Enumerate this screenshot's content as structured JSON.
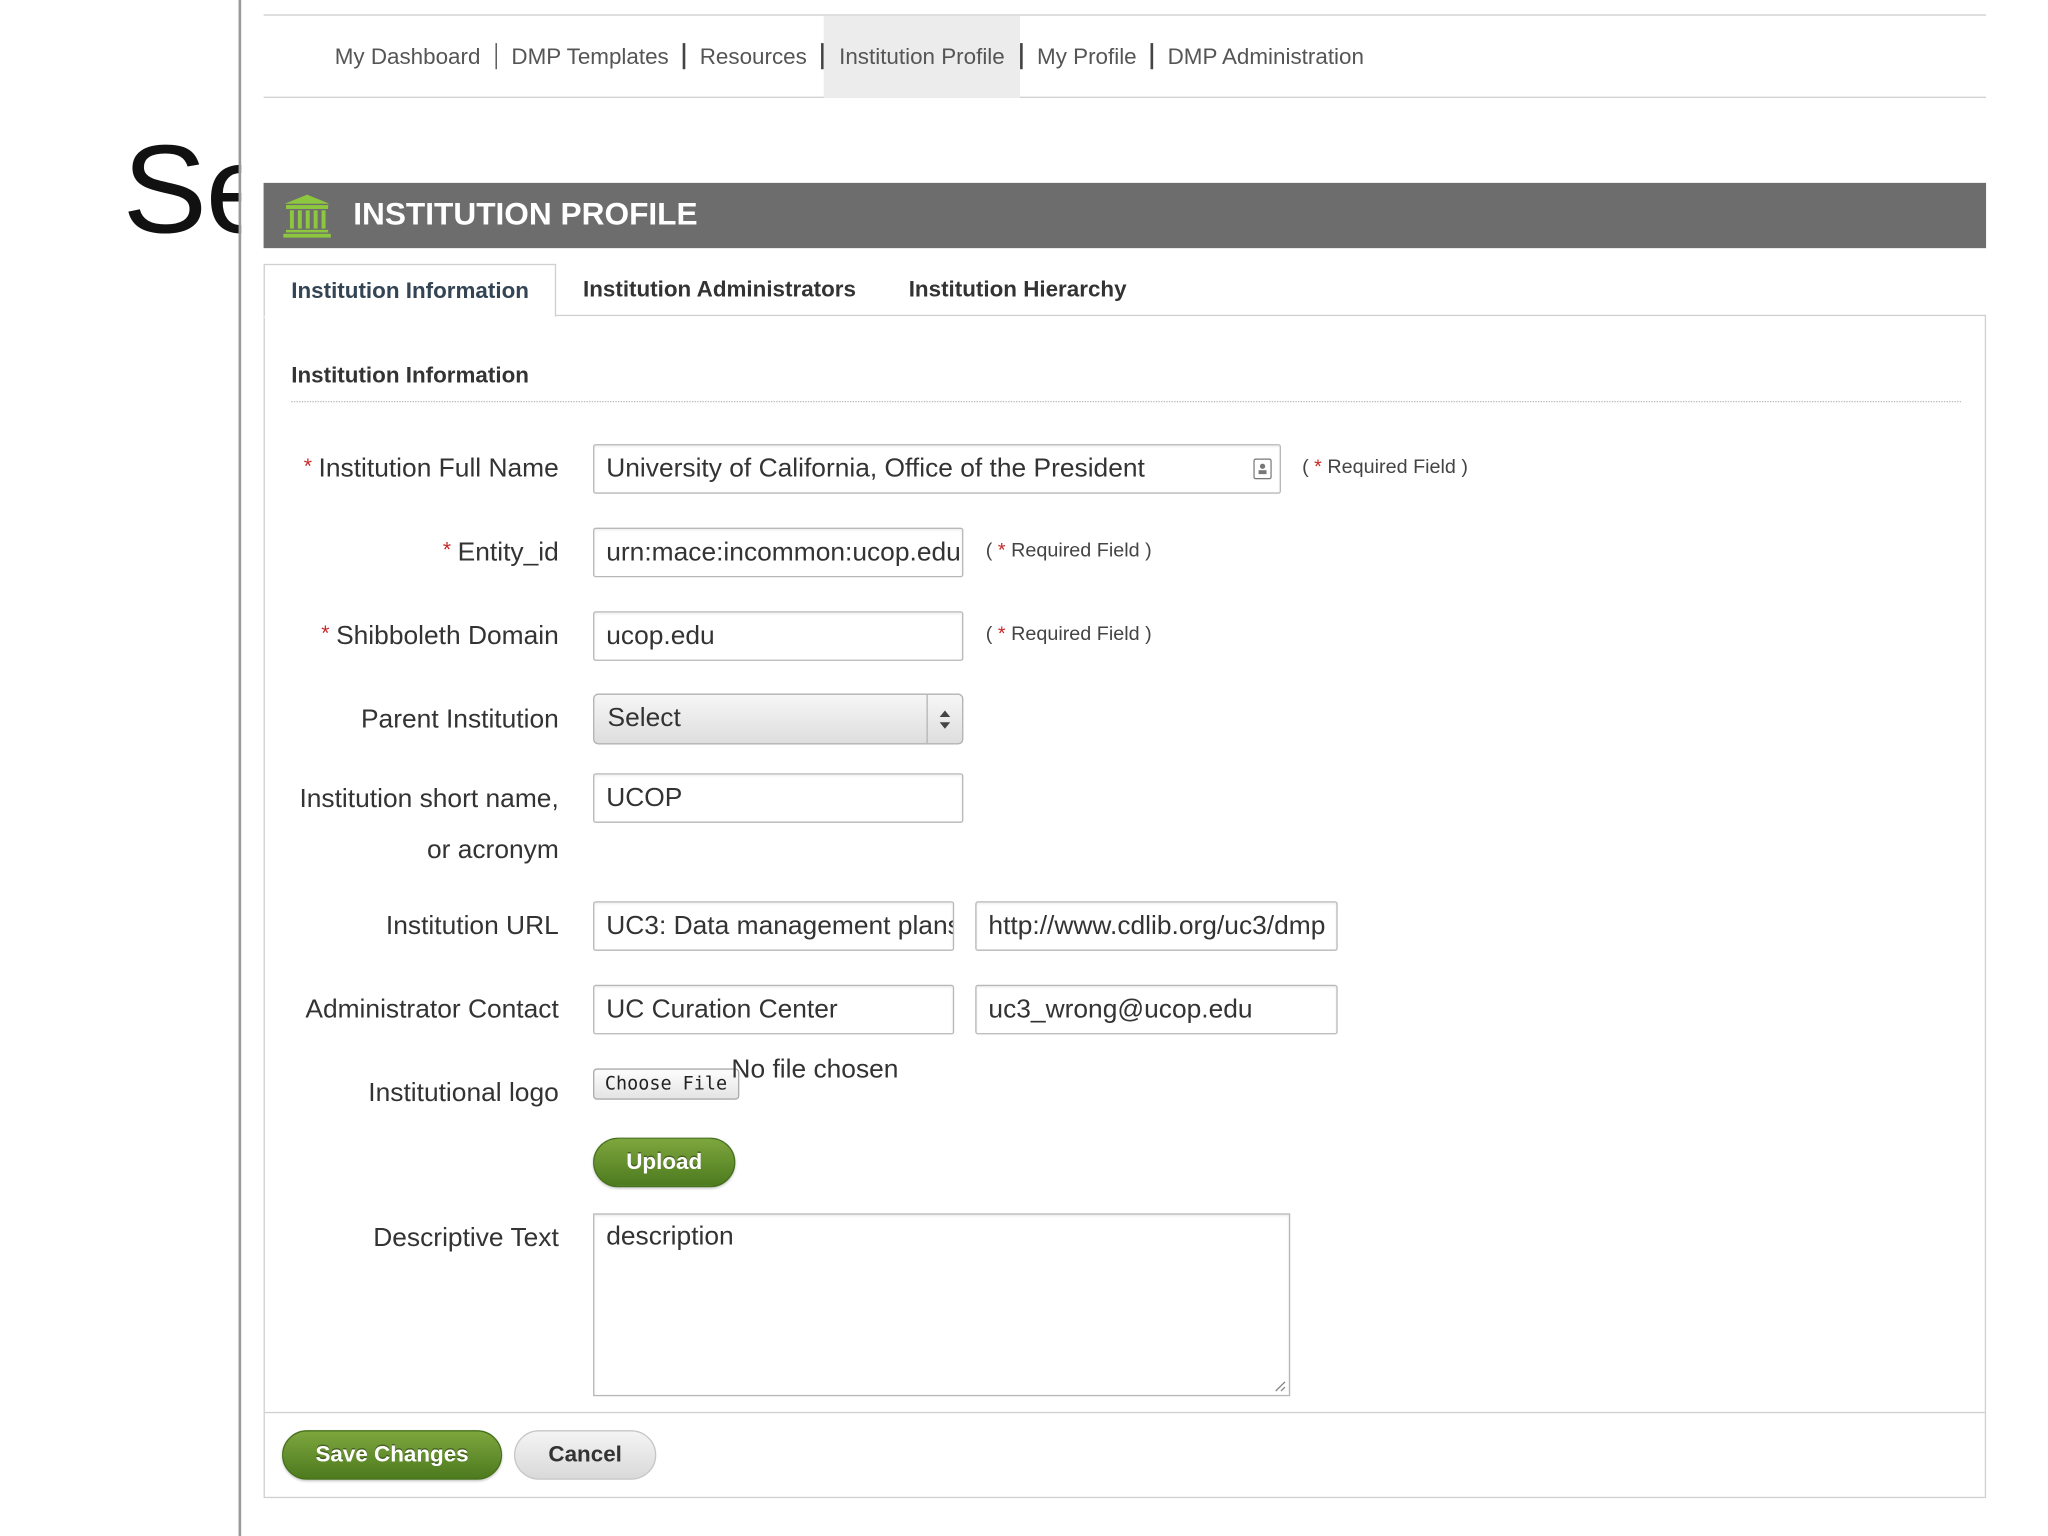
{
  "background": {
    "slide_text": "Se"
  },
  "nav": {
    "items": [
      {
        "label": "My Dashboard"
      },
      {
        "label": "DMP Templates"
      },
      {
        "label": "Resources"
      },
      {
        "label": "Institution Profile",
        "active": true
      },
      {
        "label": "My Profile"
      },
      {
        "label": "DMP Administration"
      }
    ]
  },
  "header": {
    "title": "INSTITUTION PROFILE",
    "icon": "institution-building-icon",
    "icon_color": "#8dc63f",
    "bar_color": "#6d6d6d"
  },
  "tabs": [
    {
      "label": "Institution Information",
      "active": true
    },
    {
      "label": "Institution Administrators"
    },
    {
      "label": "Institution Hierarchy"
    }
  ],
  "form": {
    "section_title": "Institution Information",
    "required_star": "*",
    "required_note_open": "( ",
    "required_note_text": " Required Field )",
    "full_name": {
      "label": "Institution Full Name",
      "value": "University of California, Office of the President"
    },
    "entity_id": {
      "label": "Entity_id",
      "value": "urn:mace:incommon:ucop.edu"
    },
    "shib_domain": {
      "label": "Shibboleth Domain",
      "value": "ucop.edu"
    },
    "parent": {
      "label": "Parent Institution",
      "selected": "Select"
    },
    "short_name": {
      "label_line1": "Institution short name,",
      "label_line2": "or acronym",
      "value": "UCOP"
    },
    "url": {
      "label": "Institution URL",
      "title_value": "UC3: Data management plans",
      "url_value": "http://www.cdlib.org/uc3/dmp"
    },
    "admin_contact": {
      "label": "Administrator Contact",
      "name_value": "UC Curation Center",
      "email_value": "uc3_wrong@ucop.edu"
    },
    "logo": {
      "label": "Institutional logo",
      "choose_label": "Choose File",
      "status": "No file chosen",
      "upload_label": "Upload"
    },
    "description": {
      "label": "Descriptive Text",
      "value": "description"
    }
  },
  "actions": {
    "save_label": "Save Changes",
    "cancel_label": "Cancel"
  },
  "colors": {
    "primary_green": "#5e8c2a",
    "required_red": "#c62828"
  }
}
